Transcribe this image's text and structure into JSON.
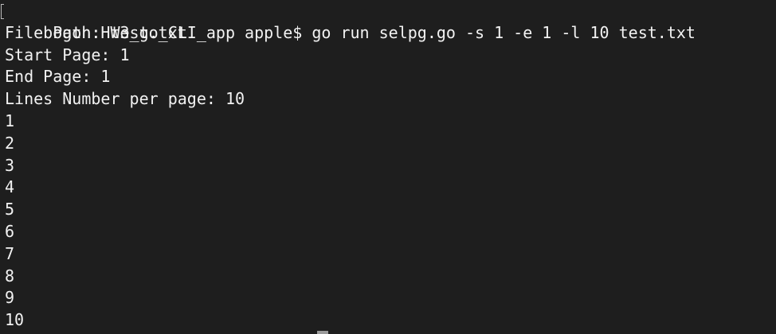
{
  "terminal": {
    "prompt": "bogon:HW3_go_CLI_app apple$ go run selpg.go -s 1 -e 1 -l 10 test.txt",
    "output": [
      "File Path: test.txt",
      "Start Page: 1",
      "End Page: 1",
      "Lines Number per page: 10",
      "1",
      "2",
      "3",
      "4",
      "5",
      "6",
      "7",
      "8",
      "9",
      "10"
    ],
    "colors": {
      "background": "#1e1e1e",
      "text": "#f2f2f2"
    }
  }
}
